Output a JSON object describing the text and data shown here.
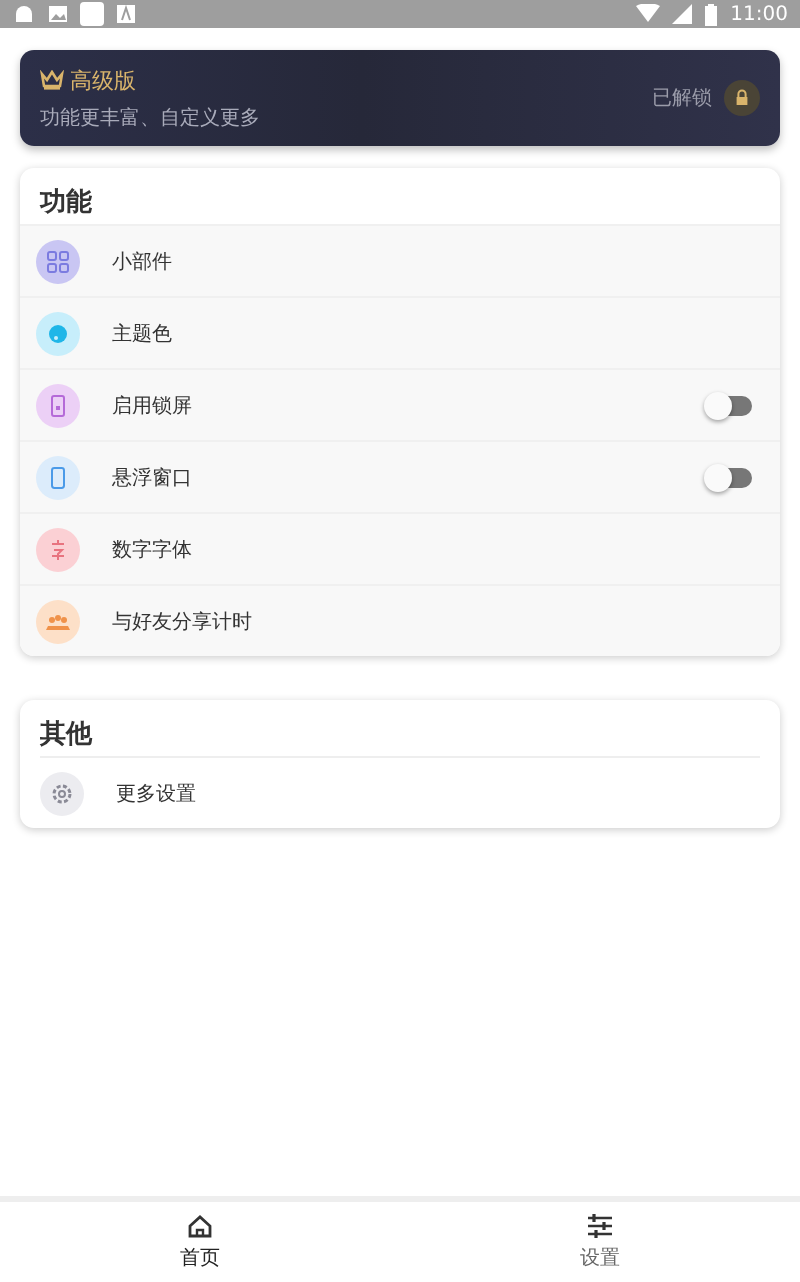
{
  "status_bar": {
    "time": "11:00"
  },
  "premium": {
    "title": "高级版",
    "subtitle": "功能更丰富、自定义更多",
    "status": "已解锁"
  },
  "sections": [
    {
      "title": "功能",
      "items": [
        {
          "label": "小部件",
          "kind": "link",
          "color": "#c9c6f3"
        },
        {
          "label": "主题色",
          "kind": "link",
          "color": "#c7eefb"
        },
        {
          "label": "启用锁屏",
          "kind": "toggle",
          "on": false,
          "color": "#ecd0f6"
        },
        {
          "label": "悬浮窗口",
          "kind": "toggle",
          "on": false,
          "color": "#dcecfb"
        },
        {
          "label": "数字字体",
          "kind": "link",
          "color": "#fbd0d4"
        },
        {
          "label": "与好友分享计时",
          "kind": "link",
          "color": "#fde0c8"
        }
      ]
    },
    {
      "title": "其他",
      "items": [
        {
          "label": "更多设置",
          "kind": "link",
          "color": "#ececf0"
        }
      ]
    }
  ],
  "nav": [
    {
      "label": "首页",
      "selected": true
    },
    {
      "label": "设置",
      "selected": false
    }
  ]
}
